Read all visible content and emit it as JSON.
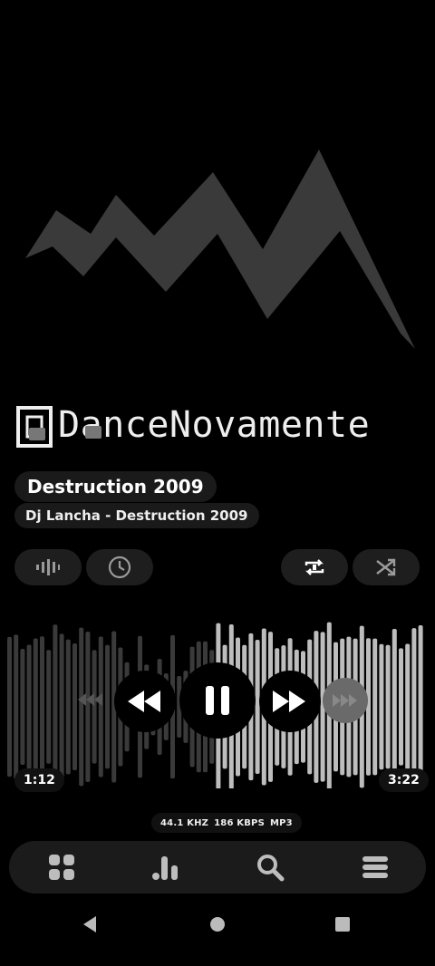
{
  "album_art": {
    "brand_text": "DanceNovamente"
  },
  "track": {
    "title": "Destruction 2009",
    "artist_line": "Dj Lancha - Destruction 2009"
  },
  "controls": {
    "visualizer_icon": "waveform-icon",
    "sleep_timer_icon": "clock-icon",
    "repeat_icon": "repeat-one-icon",
    "shuffle_icon": "shuffle-icon"
  },
  "playback": {
    "elapsed": "1:12",
    "duration": "3:22",
    "progress": 0.356,
    "state": "playing"
  },
  "audio_info": {
    "sample_rate": "44.1 KHZ",
    "bitrate": "186 KBPS",
    "format": "MP3"
  },
  "bottom_nav": [
    {
      "icon": "grid-icon"
    },
    {
      "icon": "bar-chart-icon"
    },
    {
      "icon": "search-icon"
    },
    {
      "icon": "menu-icon"
    }
  ],
  "system_nav": [
    {
      "icon": "back-icon"
    },
    {
      "icon": "home-icon"
    },
    {
      "icon": "recents-icon"
    }
  ],
  "colors": {
    "background": "#000000",
    "pill": "#1a1a1a",
    "wave_played": "#bdbdbd",
    "wave_unplayed": "#3a3a3a",
    "art_shape": "#3b3b3b"
  }
}
